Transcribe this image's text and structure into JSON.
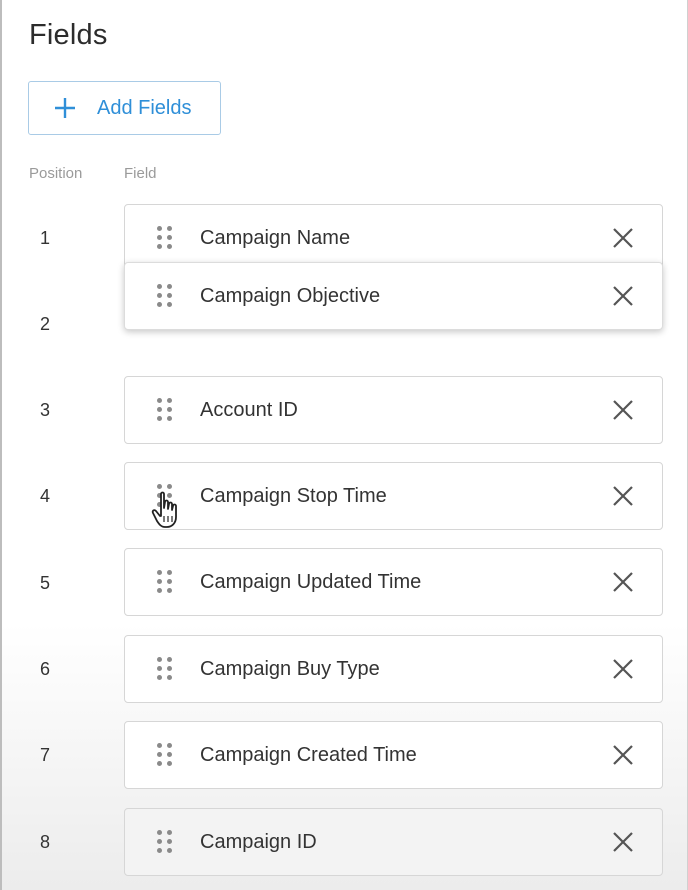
{
  "panel": {
    "title": "Fields",
    "add_button_label": "Add Fields"
  },
  "columns": {
    "position": "Position",
    "field": "Field"
  },
  "positions": [
    "1",
    "2",
    "3",
    "4",
    "5",
    "6",
    "7",
    "8"
  ],
  "fields": [
    {
      "label": "Campaign Name"
    },
    {
      "label": "Campaign Objective"
    },
    {
      "label": "Account ID"
    },
    {
      "label": "Campaign Stop Time"
    },
    {
      "label": "Campaign Updated Time"
    },
    {
      "label": "Campaign Buy Type"
    },
    {
      "label": "Campaign Created Time"
    },
    {
      "label": "Campaign ID"
    }
  ],
  "icons": {
    "add": "plus-icon",
    "drag": "drag-handle-icon",
    "remove": "close-icon",
    "cursor": "hand-cursor-icon"
  },
  "colors": {
    "accent": "#2f8fd8",
    "button_border": "#a9cbe6",
    "card_border": "#d6d6d6",
    "muted_text": "#9a9a9a"
  }
}
